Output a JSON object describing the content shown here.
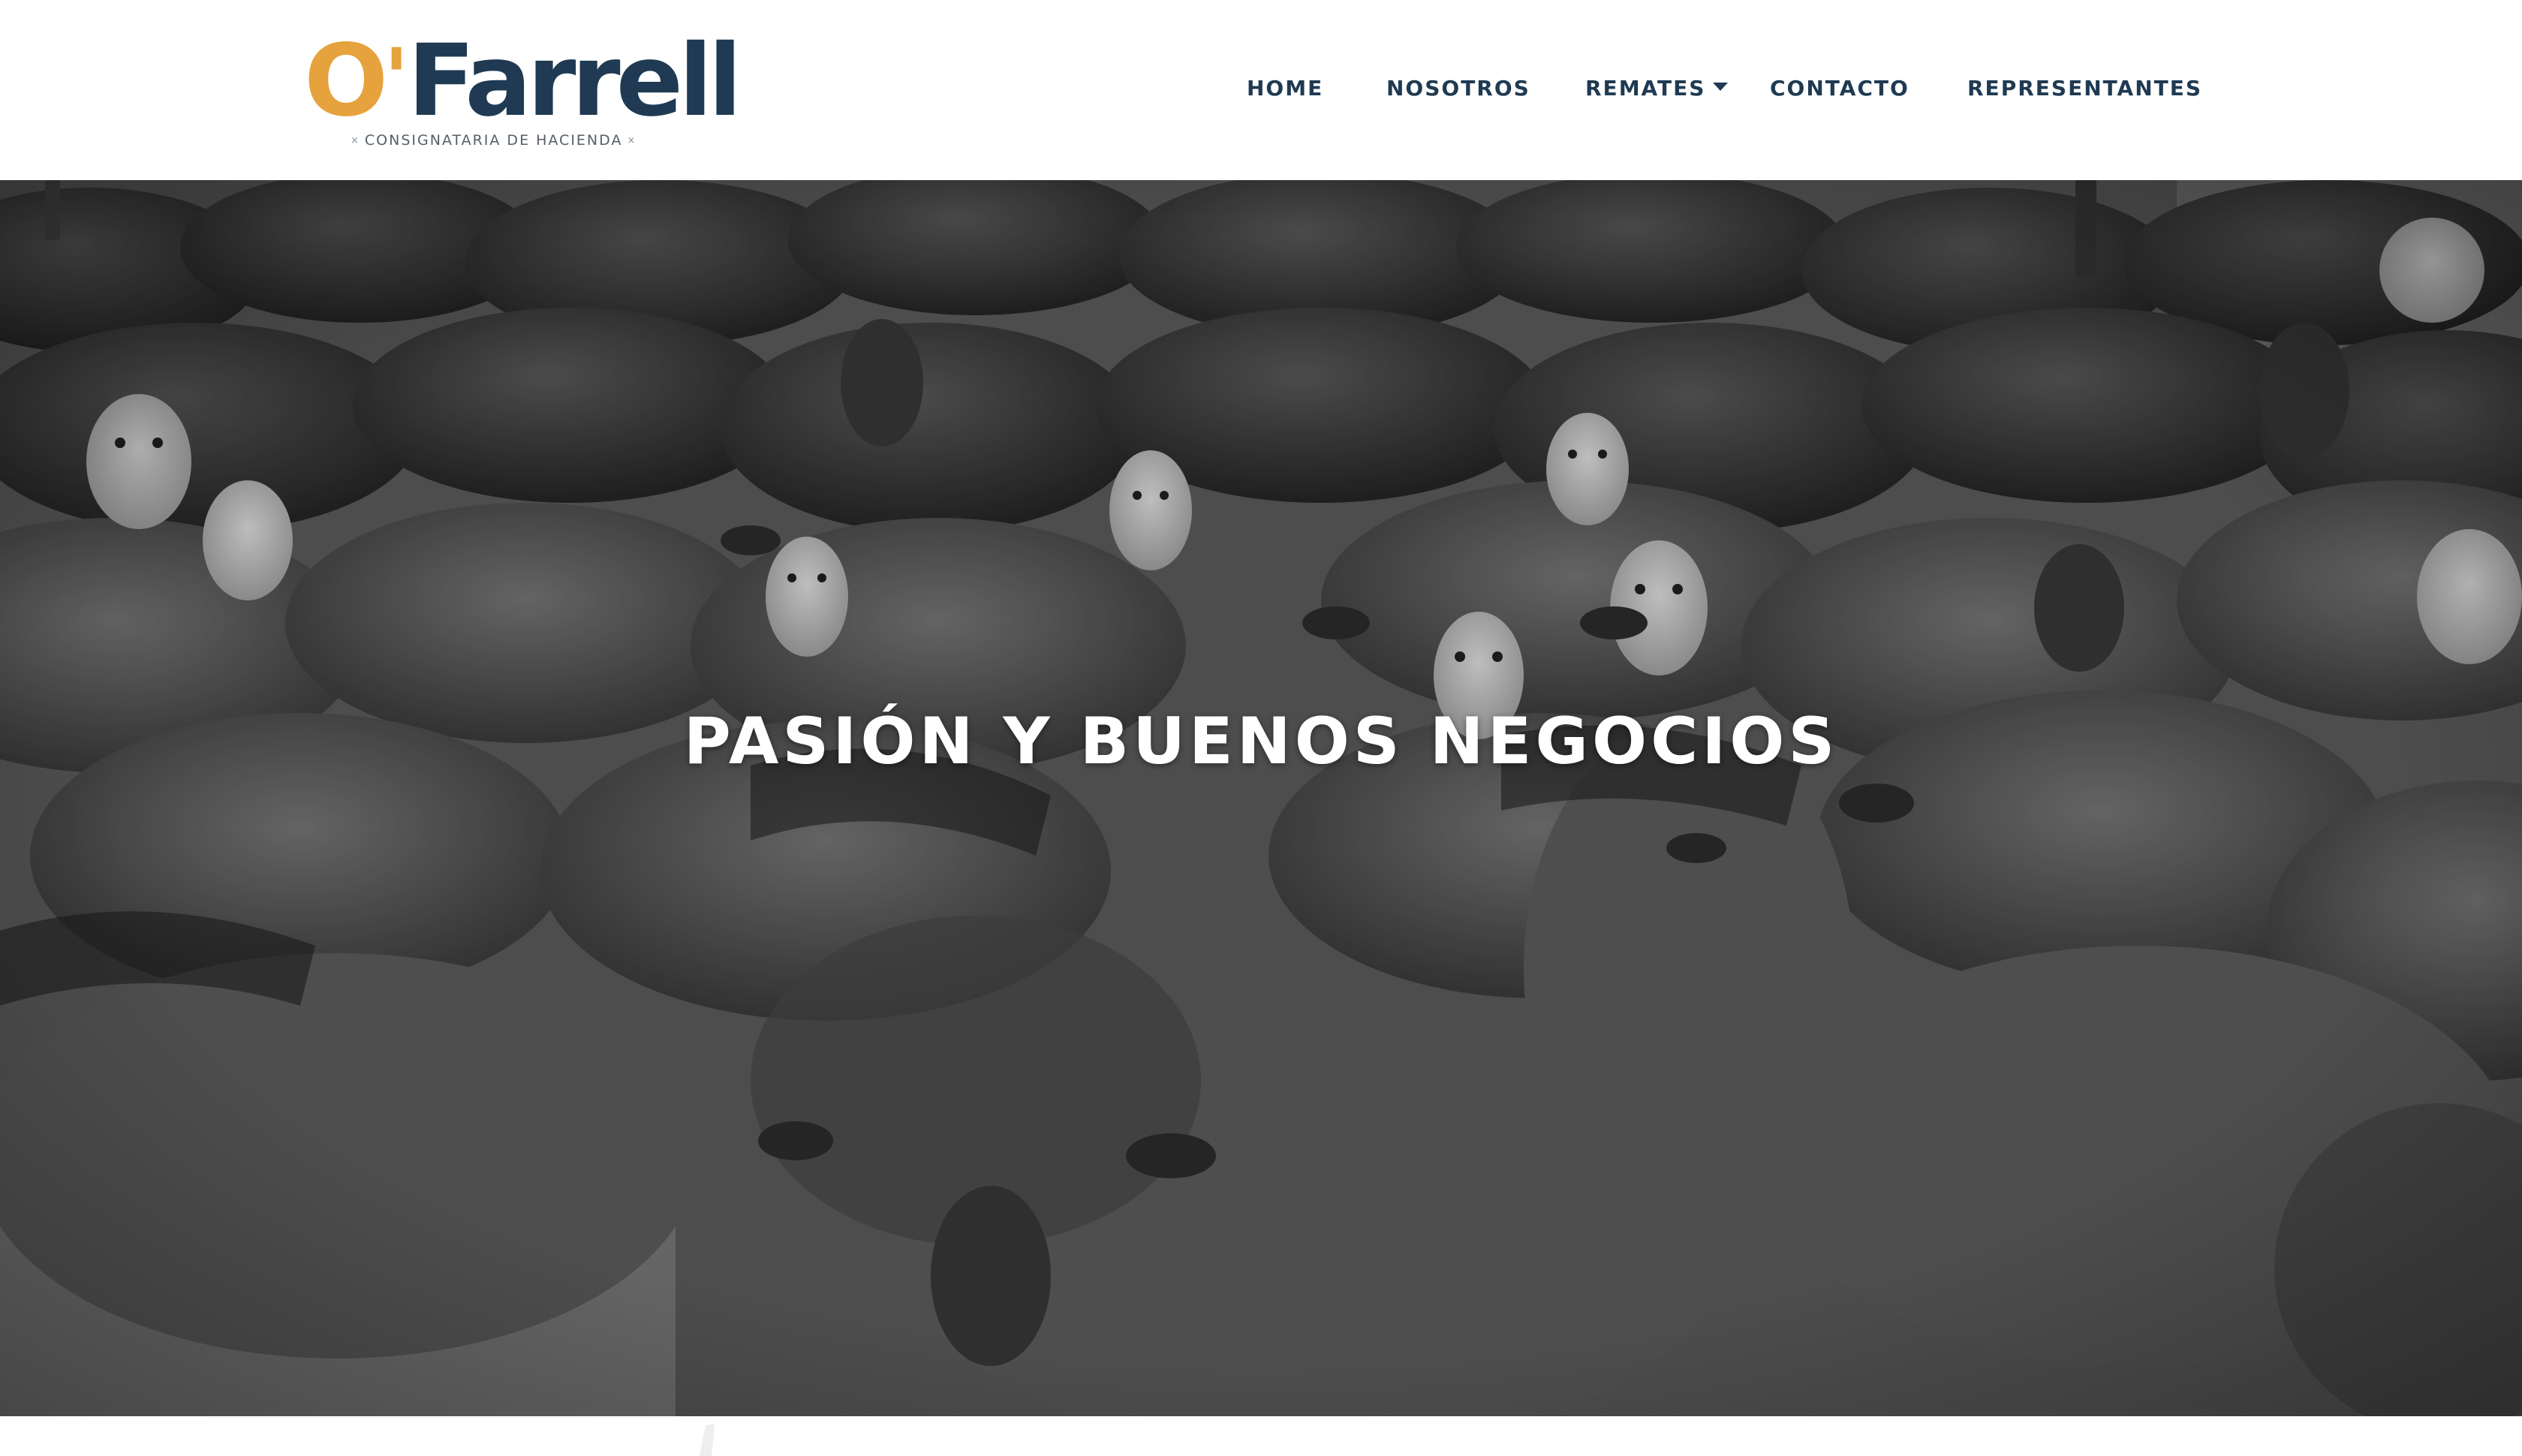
{
  "header": {
    "logo": {
      "mark_o": "O",
      "mark_apostrophe": "'",
      "mark_rest": "Farrell",
      "tagline": "CONSIGNATARIA DE HACIENDA",
      "tagline_ornament": "×"
    },
    "nav": {
      "home": "HOME",
      "nosotros": "NOSOTROS",
      "remates": "REMATES",
      "contacto": "CONTACTO",
      "representantes": "REPRESENTANTES"
    }
  },
  "hero": {
    "title": "PASIÓN Y BUENOS NEGOCIOS",
    "background_icon": "cattle-herd-photo"
  },
  "colors": {
    "brand_navy": "#1f3a52",
    "brand_gold": "#e6a23c",
    "hero_text": "#ffffff"
  }
}
